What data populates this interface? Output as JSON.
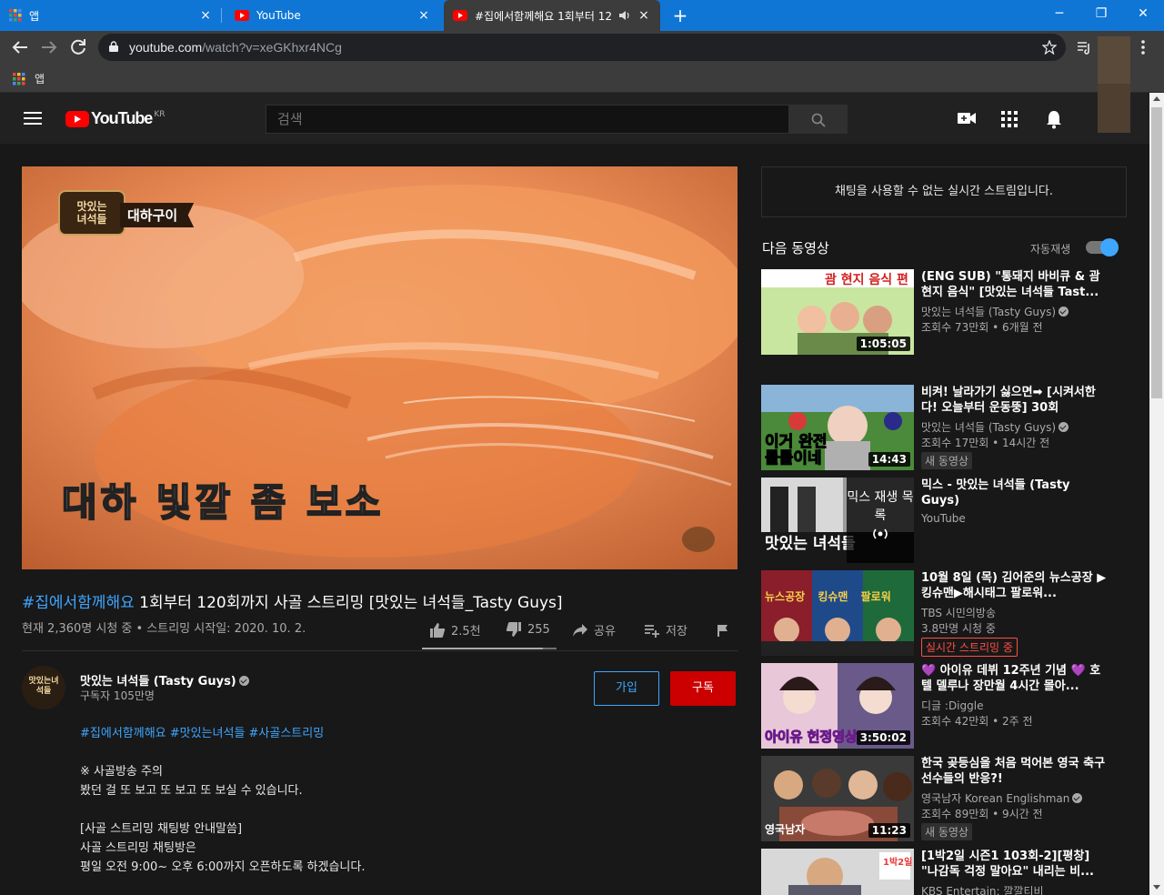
{
  "browser": {
    "tabs": [
      {
        "label": "앱",
        "close": "×"
      },
      {
        "label": "YouTube",
        "close": "×"
      },
      {
        "label": "#집에서함께해요 1회부터 12",
        "close": "×"
      }
    ],
    "new_tab": "+",
    "window": {
      "minimize": "─",
      "restore": "❐",
      "close": "✕"
    },
    "url_host": "youtube.com",
    "url_path": "/watch?v=xeGKhxr4NCg",
    "bookmark_apps": "앱"
  },
  "youtube": {
    "logo_text": "YouTube",
    "logo_region": "KR",
    "search_placeholder": "검색"
  },
  "video": {
    "overlay_logo_line1": "맛있는",
    "overlay_logo_line2": "녀석들",
    "overlay_caption": "대하구이",
    "overlay_subtitle": "대하 빛깔 좀 보소",
    "title_tag": "#집에서함께해요",
    "title_rest": " 1회부터 120회까지 사골 스트리밍 [맛있는 녀석들_Tasty Guys]",
    "meta": "현재 2,360명 시청 중 • 스트리밍 시작일: 2020. 10. 2.",
    "likes": "2.5천",
    "dislikes": "255",
    "like_ratio": 0.9,
    "share": "공유",
    "save": "저장"
  },
  "channel": {
    "avatar_text": "맛있는녀석들",
    "name": "맛있는 녀석들 (Tasty Guys)",
    "subscribers": "구독자 105만명",
    "join": "가입",
    "subscribe": "구독"
  },
  "description": {
    "tags": "#집에서함께해요 #맛있는녀석들 #사골스트리밍",
    "line1": "※ 사골방송 주의",
    "line2": "봤던 걸 또 보고 또 보고 또 보실 수 있습니다.",
    "line3": "[사골 스트리밍 채팅방 안내말씀]",
    "line4": "사골 스트리밍 채팅방은",
    "line5": "평일 오전 9:00~ 오후 6:00까지 오픈하도록 하겠습니다."
  },
  "sidebar": {
    "chat_notice": "채팅을 사용할 수 없는 실시간 스트림입니다.",
    "next_heading": "다음 동영상",
    "autoplay_label": "자동재생",
    "autoplay_on": true,
    "recs": [
      {
        "title": "(ENG SUB) \"통돼지 바비큐 & 괌 현지 음식\" [맛있는 녀석들 Tast...",
        "channel": "맛있는 녀석들 (Tasty Guys)",
        "meta": "조회수 73만회 • 6개월 전",
        "duration": "1:05:05",
        "thumb_text": "괌 현지 음식 편"
      },
      {
        "title": "비켜! 날라가기 싫으면➡ [시켜서한다! 오늘부터 운동뚱] 30회",
        "channel": "맛있는 녀석들 (Tasty Guys)",
        "meta": "조회수 17만회 • 14시간 전",
        "duration": "14:43",
        "badge": "새 동영상",
        "thumb_text": "이거 완전 롤롤이네"
      },
      {
        "title": "믹스 - 맛있는 녀석들 (Tasty Guys)",
        "channel": "YouTube",
        "mix_label": "믹스 재생 목록",
        "thumb_text": "맛있는 녀석들"
      },
      {
        "title": "10월 8일 (목) 김어준의 뉴스공장 ▶킹슈맨▶해시태그 팔로워...",
        "channel": "TBS 시민의방송",
        "meta": "3.8만명 시청 중",
        "badge_live": "실시간 스트리밍 중",
        "thumb_text": "뉴스공장 킹슈맨 팔로워"
      },
      {
        "title": "💜 아이유 데뷔 12주년 기념 💜 호텔 델루나 장만월 4시간 몰아...",
        "channel": "디글 :Diggle",
        "meta": "조회수 42만회 • 2주 전",
        "duration": "3:50:02",
        "thumb_text": "아이유 헌정영상"
      },
      {
        "title": "한국 곶등심을 처음 먹어본 영국 축구선수들의 반응?!",
        "channel": "영국남자 Korean Englishman",
        "meta": "조회수 89만회 • 9시간 전",
        "duration": "11:23",
        "badge": "새 동영상",
        "thumb_text": "영국남자"
      },
      {
        "title": "[1박2일 시즌1 103회-2][평창] \"나감독 걱정 말아요\" 내리는 비...",
        "channel": "KBS Entertain: 깔깔티비",
        "thumb_text": "1박2일"
      }
    ]
  },
  "colors": {
    "accent": "#3ea6ff",
    "subscribe": "#cc0000",
    "tabbar": "#0f76d6"
  }
}
